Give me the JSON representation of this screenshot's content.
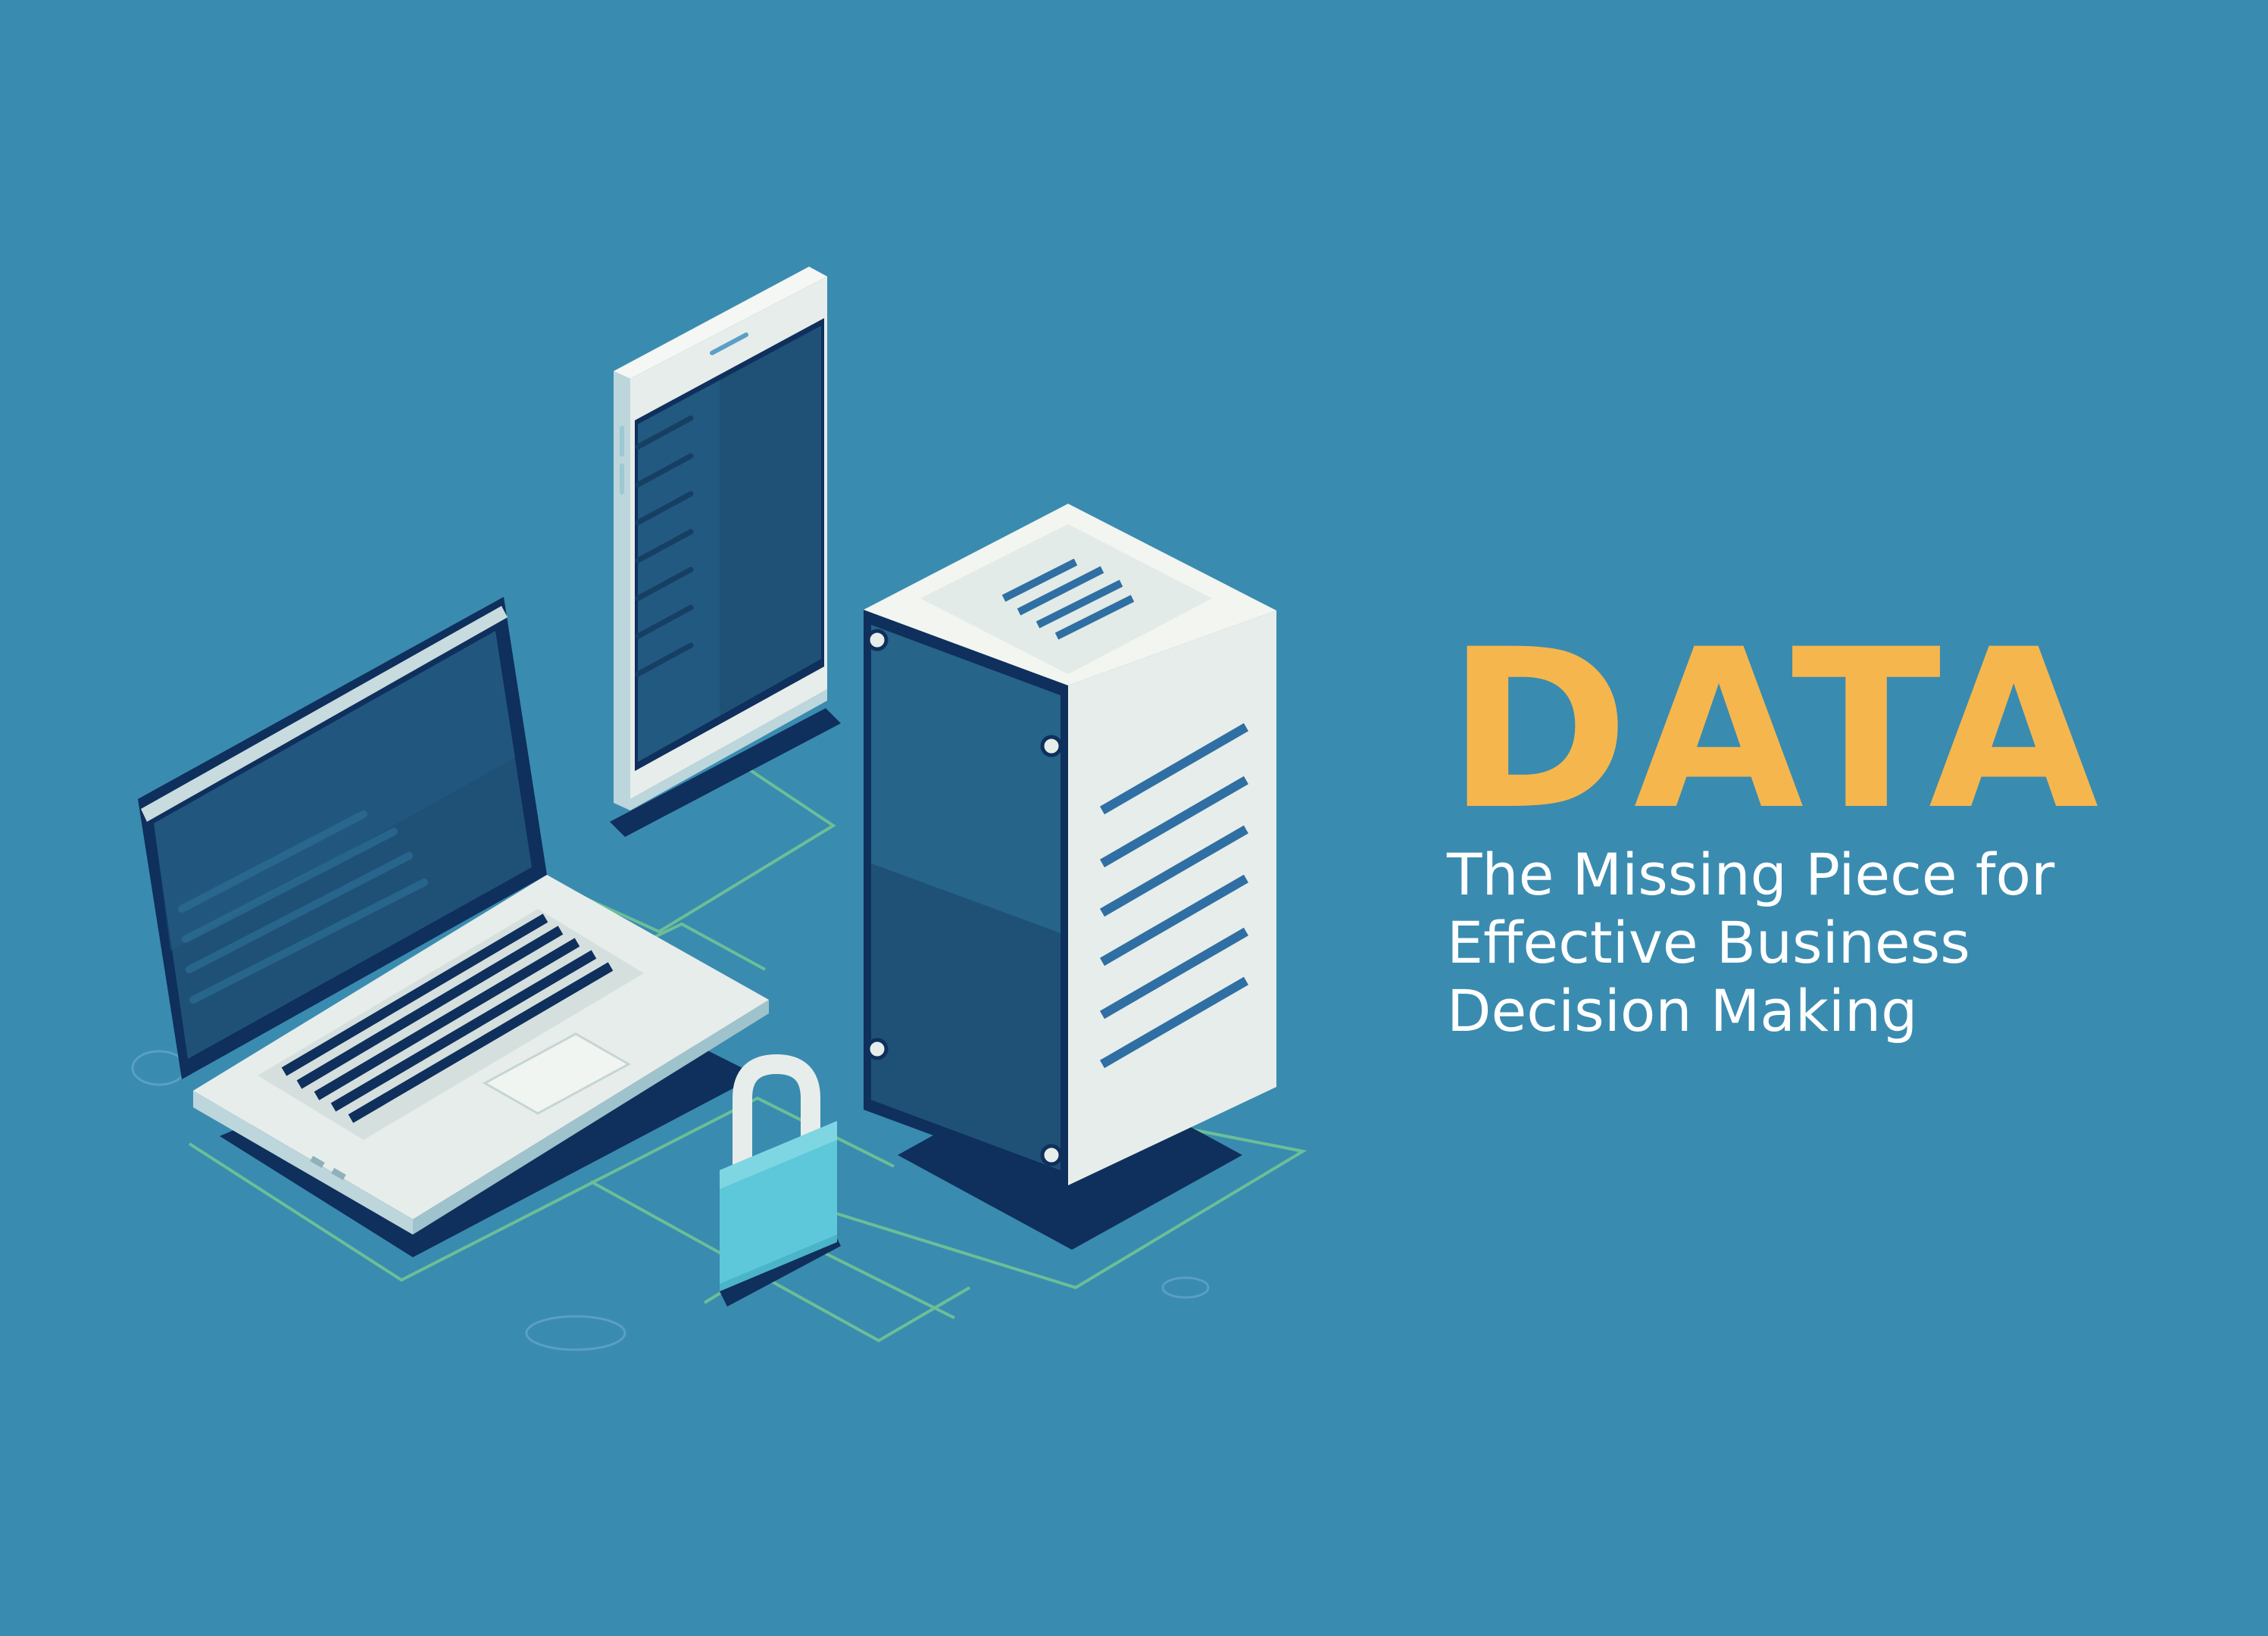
{
  "headline": "DATA",
  "subtitle_lines": [
    "The Missing Piece for",
    "Effective Business",
    "Decision Making"
  ],
  "colors": {
    "background": "#3a8bb0",
    "headline": "#f6b64e",
    "subtitle": "#ffffff",
    "screen": "#1f5177",
    "screen_frame": "#0f2f5c",
    "device_body": "#e7edea",
    "device_side": "#bcd6dc",
    "lock": "#5cc8d9",
    "circuit": "#7cd08f"
  },
  "icons": [
    "laptop-icon",
    "smartphone-icon",
    "server-tower-icon",
    "padlock-icon",
    "circuit-lines"
  ]
}
